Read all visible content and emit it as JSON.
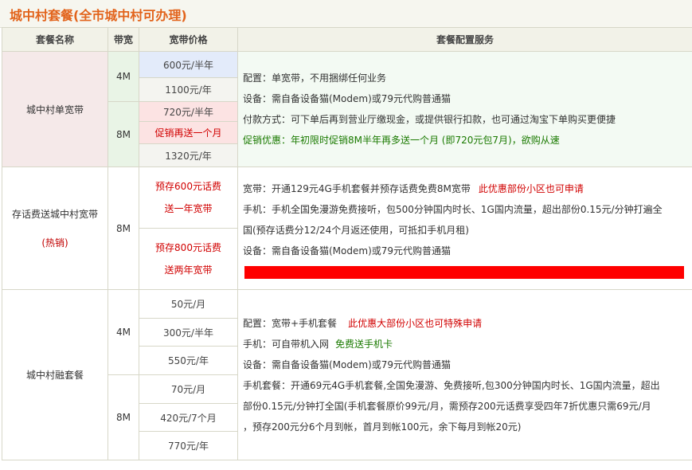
{
  "title": "城中村套餐(全市城中村可办理)",
  "headers": {
    "name": "套餐名称",
    "bandwidth": "带宽",
    "price": "宽带价格",
    "services": "套餐配置服务"
  },
  "packages": [
    {
      "name": "城中村单宽带",
      "rows": [
        {
          "bandwidth": "4M",
          "prices": [
            "600元/半年",
            "1100元/年"
          ]
        },
        {
          "bandwidth": "8M",
          "prices": [
            "720元/半年",
            "促销再送一个月",
            "1320元/年"
          ]
        }
      ],
      "services": {
        "l1": "配置：单宽带，不用捆绑任何业务",
        "l2": "设备：需自备设备猫(Modem)或79元代购普通猫",
        "l3": "付款方式：可下单后再到营业厅缴现金，或提供银行扣款，也可通过淘宝下单购买更便捷",
        "l4": "促销优惠：年初限时促销8M半年再多送一个月 (即720元包7月)，欲购从速"
      }
    },
    {
      "name": "存话费送城中村宽带",
      "tag": "(热销)",
      "bandwidth": "8M",
      "offers": [
        {
          "line1": "预存600元话费",
          "line2": "送一年宽带"
        },
        {
          "line1": "预存800元话费",
          "line2": "送两年宽带"
        }
      ],
      "services": {
        "l1a": "宽带：开通129元4G手机套餐并预存话费免费8M宽带",
        "l1b": "此优惠部份小区也可申请",
        "l2": "手机：手机全国免漫游免费接听，包500分钟国内时长、1G国内流量，超出部份0.15元/分钟打遍全",
        "l3": "国(预存话费分12/24个月返还使用，可抵扣手机月租)",
        "l4": "设备：需自备设备猫(Modem)或79元代购普通猫"
      }
    },
    {
      "name": "城中村融套餐",
      "rows": [
        {
          "bandwidth": "4M",
          "prices": [
            "50元/月",
            "300元/半年",
            "550元/年"
          ]
        },
        {
          "bandwidth": "8M",
          "prices": [
            "70元/月",
            "420元/7个月",
            "770元/年"
          ]
        }
      ],
      "services": {
        "l1a": "配置：宽带+手机套餐",
        "l1b": "此优惠大部份小区也可特殊申请",
        "l2a": "手机：可自带机入网",
        "l2b": "免费送手机卡",
        "l3": "设备：需自备设备猫(Modem)或79元代购普通猫",
        "l4": "手机套餐：开通69元4G手机套餐,全国免漫游、免费接听,包300分钟国内时长、1G国内流量，超出",
        "l5": "部份0.15元/分钟打全国(手机套餐原价99元/月，需预存200元话费享受四年7折优惠只需69元/月",
        "l6": "，预存200元分6个月到帐，首月到帐100元，余下每月到帐20元)"
      }
    }
  ],
  "colors": {
    "title": "#e2631b",
    "promo_red": "#d10000",
    "promo_green": "#1a7a00",
    "bar_red": "#ff0000"
  }
}
